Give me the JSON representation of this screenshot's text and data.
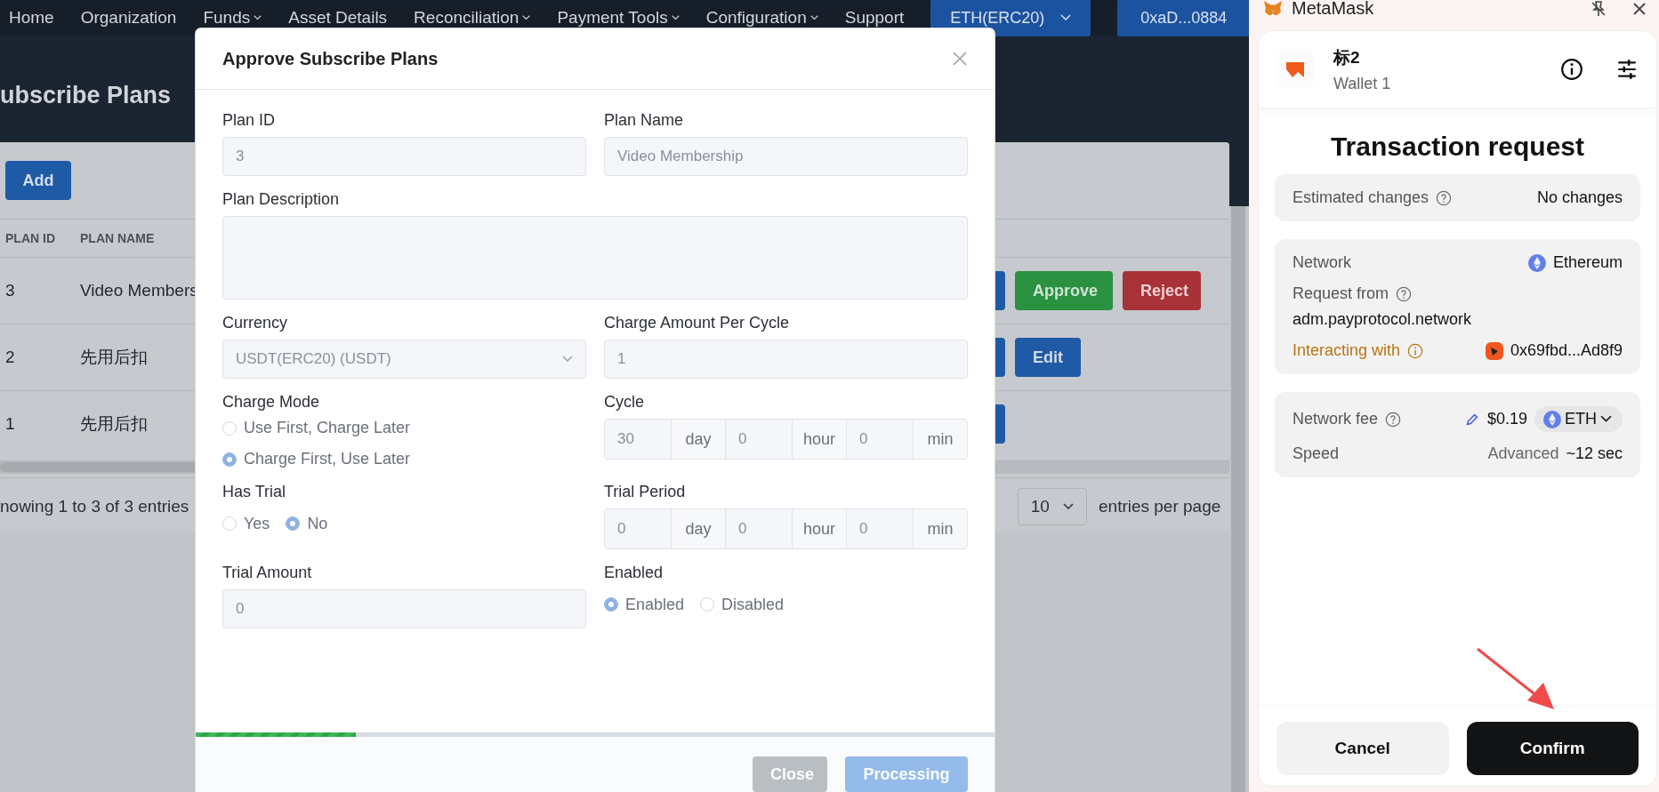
{
  "nav": {
    "items": [
      {
        "label": "Home",
        "dropdown": false
      },
      {
        "label": "Organization",
        "dropdown": false
      },
      {
        "label": "Funds",
        "dropdown": true
      },
      {
        "label": "Asset Details",
        "dropdown": false
      },
      {
        "label": "Reconciliation",
        "dropdown": true
      },
      {
        "label": "Payment Tools",
        "dropdown": true
      },
      {
        "label": "Configuration",
        "dropdown": true
      },
      {
        "label": "Support",
        "dropdown": false
      }
    ],
    "network_button": "ETH(ERC20)",
    "account_button": "0xaD...0884"
  },
  "page": {
    "title": "ubscribe Plans",
    "add_button": "Add",
    "table": {
      "columns": [
        "PLAN ID",
        "PLAN NAME"
      ],
      "rows": [
        {
          "plan_id": "3",
          "plan_name": "Video Members",
          "actions": [
            {
              "kind": "primary"
            },
            {
              "kind": "success",
              "label": "Approve"
            },
            {
              "kind": "danger",
              "label": "Reject"
            }
          ]
        },
        {
          "plan_id": "2",
          "plan_name": "先用后扣",
          "actions": [
            {
              "kind": "primary"
            },
            {
              "kind": "primary",
              "label": "Edit"
            }
          ]
        },
        {
          "plan_id": "1",
          "plan_name": "先用后扣",
          "actions": [
            {
              "kind": "primary"
            }
          ]
        }
      ]
    },
    "pagination": {
      "summary": "nowing 1 to 3 of 3 entries",
      "page_size": "10",
      "page_size_label": "entries per page"
    }
  },
  "modal": {
    "title": "Approve Subscribe Plans",
    "fields": [
      {
        "kind": "input",
        "label": "Plan ID",
        "value": "3",
        "disabled": true
      },
      {
        "kind": "input",
        "label": "Plan Name",
        "value": "Video Membership",
        "disabled": true
      },
      {
        "kind": "textarea",
        "label": "Plan Description",
        "disabled": true
      },
      {
        "kind": "select",
        "label": "Currency",
        "value": "USDT(ERC20) (USDT)",
        "disabled": true
      },
      {
        "kind": "input",
        "label": "Charge Amount Per Cycle",
        "value": "1",
        "disabled": true
      },
      {
        "kind": "radiolist",
        "label": "Charge Mode",
        "options": [
          {
            "label": "Use First, Charge Later",
            "selected": false
          },
          {
            "label": "Charge First, Use Later",
            "selected": true
          }
        ]
      },
      {
        "kind": "duration",
        "label": "Cycle",
        "parts": [
          {
            "value": "30",
            "unit": "day"
          },
          {
            "value": "0",
            "unit": "hour"
          },
          {
            "value": "0",
            "unit": "min"
          }
        ]
      },
      {
        "kind": "radio",
        "label": "Has Trial",
        "options": [
          {
            "label": "Yes",
            "selected": false
          },
          {
            "label": "No",
            "selected": true
          }
        ]
      },
      {
        "kind": "duration",
        "label": "Trial Period",
        "parts": [
          {
            "value": "0",
            "unit": "day"
          },
          {
            "value": "0",
            "unit": "hour"
          },
          {
            "value": "0",
            "unit": "min"
          }
        ]
      },
      {
        "kind": "input",
        "label": "Trial Amount",
        "value": "0",
        "disabled": true
      },
      {
        "kind": "radio",
        "label": "Enabled",
        "options": [
          {
            "label": "Enabled",
            "selected": true
          },
          {
            "label": "Disabled",
            "selected": false
          }
        ]
      }
    ],
    "progress": {
      "level": 0.2
    },
    "buttons": [
      {
        "label": "Close",
        "kind": "secondary",
        "disabled": true
      },
      {
        "label": "Processing",
        "kind": "primary",
        "disabled": true
      }
    ]
  },
  "wallet": {
    "app_name": "MetaMask",
    "account": {
      "name": "标2",
      "wallet": "Wallet 1"
    },
    "title": "Transaction request",
    "estimated_changes": {
      "label": "Estimated changes",
      "value": "No changes"
    },
    "network": {
      "label": "Network",
      "value": "Ethereum"
    },
    "request_from": {
      "label": "Request from",
      "value": "adm.payprotocol.network"
    },
    "interacting_with": {
      "label": "Interacting with",
      "value": "0x69fbd...Ad8f9"
    },
    "network_fee": {
      "label": "Network fee",
      "value": "$0.19",
      "token": "ETH"
    },
    "speed": {
      "label": "Speed",
      "mode": "Advanced",
      "value": "~12 sec"
    },
    "buttons": [
      {
        "label": "Cancel",
        "kind": "secondary"
      },
      {
        "label": "Confirm",
        "kind": "primary"
      }
    ]
  }
}
